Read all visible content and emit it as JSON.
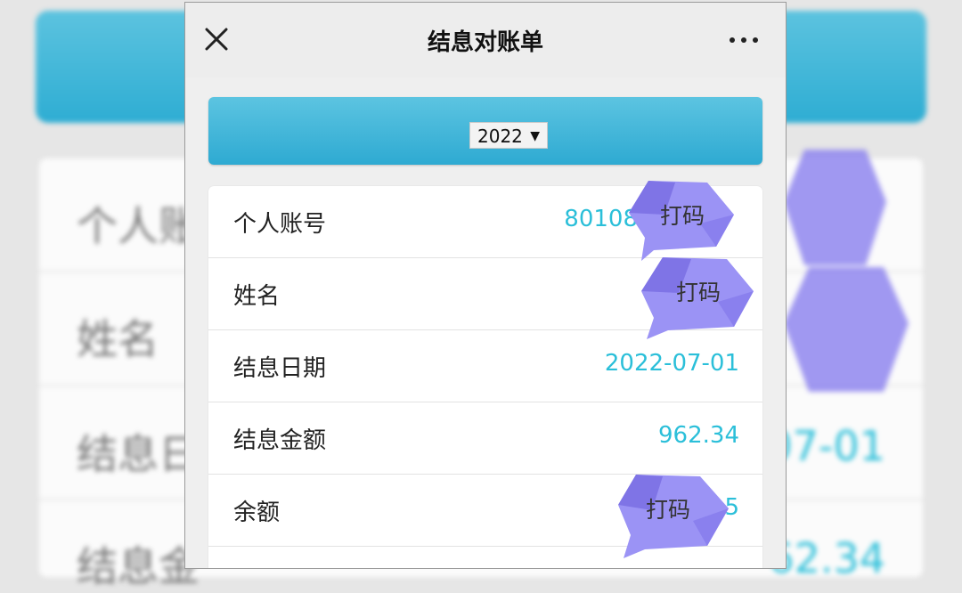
{
  "nav": {
    "title": "结息对账单"
  },
  "year_select": {
    "value": "2022",
    "caret": "▼"
  },
  "rows": [
    {
      "label": "个人账号",
      "value": "80108"
    },
    {
      "label": "姓名",
      "value": ""
    },
    {
      "label": "结息日期",
      "value": "2022-07-01"
    },
    {
      "label": "结息金额",
      "value": "962.34"
    },
    {
      "label": "余额",
      "value": "5"
    }
  ],
  "redaction": {
    "text": "打码"
  },
  "background": {
    "rows": [
      "个人账",
      "姓名",
      "结息日",
      "结息金"
    ],
    "values": [
      "",
      "",
      "07-01",
      "62.34"
    ]
  },
  "colors": {
    "accent": "#2bbfd9",
    "header_gradient_top": "#5cc4e1",
    "header_gradient_bottom": "#2eaad2",
    "sticker": "#9b93f5"
  }
}
